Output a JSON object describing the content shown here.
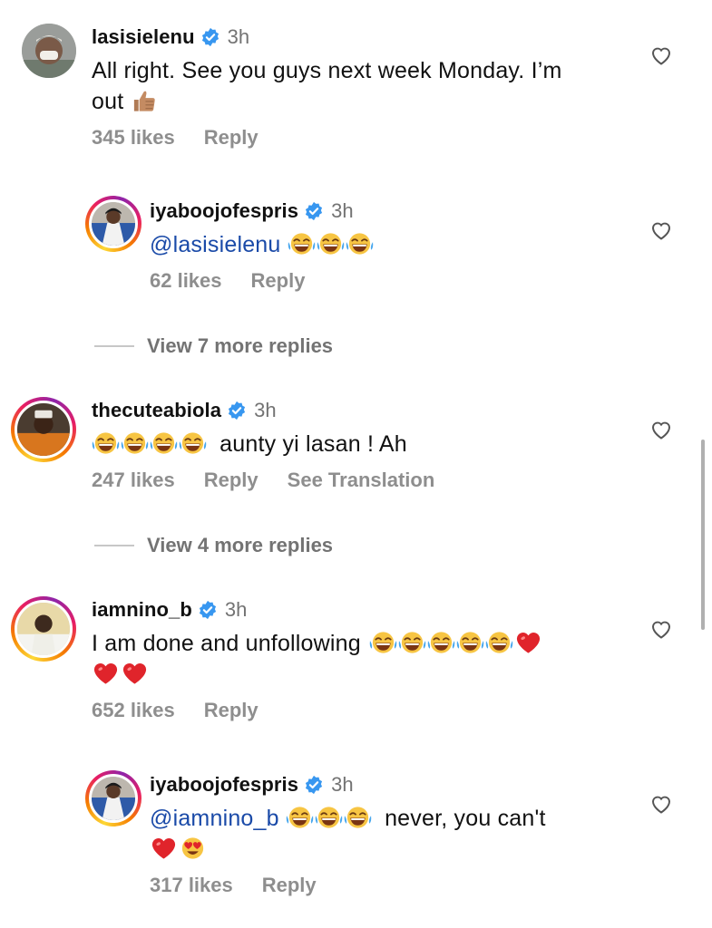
{
  "comments": [
    {
      "username": "lasisielenu",
      "time": "3h",
      "text_line1": "All right. See you guys next week Monday. I’m",
      "text_line2": "out",
      "likes": "345 likes",
      "reply": "Reply"
    },
    {
      "username": "iyaboojofespris",
      "time": "3h",
      "mention": "@lasisielenu",
      "likes": "62 likes",
      "reply": "Reply"
    },
    {
      "username": "thecuteabiola",
      "time": "3h",
      "text": "aunty yi lasan ! Ah",
      "likes": "247 likes",
      "reply": "Reply",
      "translate": "See Translation"
    },
    {
      "username": "iamnino_b",
      "time": "3h",
      "text": "I am done and unfollowing",
      "likes": "652 likes",
      "reply": "Reply"
    },
    {
      "username": "iyaboojofespris",
      "time": "3h",
      "mention": "@iamnino_b",
      "text": "never, you can't",
      "likes": "317 likes",
      "reply": "Reply"
    }
  ],
  "view_more": [
    {
      "label": "View 7 more replies"
    },
    {
      "label": "View 4 more replies"
    }
  ],
  "icons": {
    "verified": "verified-badge-icon",
    "like": "heart-outline-icon",
    "laugh": "tears-of-joy-emoji",
    "heart": "red-heart-emoji",
    "heart_eyes": "heart-eyes-emoji",
    "thumbs_up": "thumbs-up-emoji"
  },
  "colors": {
    "mention": "#1a4aa8",
    "muted": "#737373",
    "verified": "#3897f0"
  }
}
